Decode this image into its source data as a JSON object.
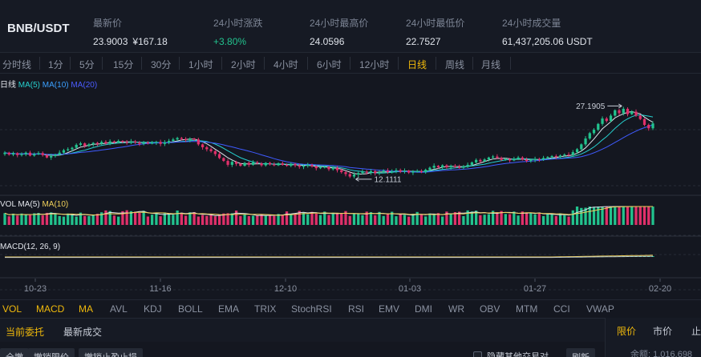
{
  "header": {
    "pair": "BNB/USDT",
    "last_label": "最新价",
    "last_price": "23.9003",
    "last_cny": "¥167.18",
    "change_label": "24小时涨跌",
    "change_value": "+3.80%",
    "high_label": "24小时最高价",
    "high_value": "24.0596",
    "low_label": "24小时最低价",
    "low_value": "22.7527",
    "volume_label": "24小时成交量",
    "volume_value": "61,437,205.06 USDT"
  },
  "intervals": [
    {
      "label": "分时线"
    },
    {
      "label": "1分"
    },
    {
      "label": "5分"
    },
    {
      "label": "15分"
    },
    {
      "label": "30分"
    },
    {
      "label": "1小时"
    },
    {
      "label": "2小时"
    },
    {
      "label": "4小时"
    },
    {
      "label": "6小时"
    },
    {
      "label": "12小时"
    },
    {
      "label": "日线"
    },
    {
      "label": "周线"
    },
    {
      "label": "月线"
    }
  ],
  "active_interval": "日线",
  "legends": {
    "main_prefix": "日线",
    "ma5": "MA(5)",
    "ma10": "MA(10)",
    "ma20": "MA(20)",
    "vol_prefix": "VOL",
    "vol_ma5": "MA(5)",
    "vol_ma10": "MA(10)",
    "macd": "MACD(12, 26, 9)"
  },
  "chart_data": {
    "type": "candlestick",
    "x_ticks": [
      "10-23",
      "11-16",
      "12-10",
      "01-03",
      "01-27",
      "02-20"
    ],
    "max_label": "27.1905",
    "min_label": "12.1111",
    "ylim": [
      9.8,
      30.5
    ],
    "series_colors": {
      "up": "#22c38e",
      "down": "#e0306a",
      "ma5": "#dfe3ea",
      "ma10": "#26d0ce",
      "ma20": "#3f5bff",
      "vol_ma5": "#dfe3ea",
      "vol_ma10": "#f0d05a"
    },
    "closes": [
      17.9,
      17.5,
      17.8,
      17.4,
      17.6,
      17.9,
      17.3,
      17.6,
      17.8,
      17.4,
      16.9,
      17.2,
      17.5,
      17.9,
      18.4,
      18.6,
      18.9,
      19.5,
      19.8,
      19.3,
      19.6,
      19.9,
      19.7,
      20.1,
      19.8,
      20.2,
      20.0,
      20.3,
      20.1,
      19.9,
      20.2,
      20.0,
      19.7,
      20.0,
      19.8,
      19.9,
      20.1,
      19.7,
      20.0,
      20.3,
      20.6,
      20.9,
      20.7,
      20.5,
      20.8,
      20.6,
      19.6,
      19.0,
      18.6,
      18.2,
      17.6,
      16.8,
      16.2,
      15.4,
      16.0,
      15.6,
      15.2,
      15.8,
      15.4,
      15.9,
      15.7,
      15.3,
      15.8,
      15.5,
      15.3,
      15.7,
      15.4,
      15.2,
      15.6,
      15.3,
      15.0,
      15.2,
      15.4,
      15.1,
      14.7,
      14.9,
      15.0,
      14.5,
      14.8,
      14.3,
      13.9,
      13.5,
      13.0,
      13.4,
      13.7,
      14.0,
      13.8,
      14.1,
      13.7,
      13.9,
      14.2,
      13.9,
      14.1,
      14.3,
      14.0,
      14.2,
      13.8,
      14.0,
      14.1,
      13.9,
      14.4,
      14.8,
      15.2,
      14.9,
      15.3,
      14.9,
      15.2,
      15.0,
      14.8,
      15.1,
      15.4,
      15.9,
      16.4,
      16.1,
      16.5,
      16.9,
      17.1,
      16.8,
      16.4,
      16.6,
      16.3,
      16.6,
      16.9,
      16.5,
      16.2,
      16.4,
      16.6,
      16.5,
      16.8,
      17.0,
      17.2,
      17.0,
      17.3,
      17.5,
      17.4,
      18.0,
      18.6,
      19.6,
      20.8,
      21.9,
      22.6,
      23.8,
      24.9,
      24.4,
      25.5,
      26.6,
      26.0,
      26.9,
      25.8,
      26.3,
      25.5,
      24.8,
      23.6,
      22.9,
      23.9
    ]
  },
  "indicators": [
    {
      "label": "VOL"
    },
    {
      "label": "MACD"
    },
    {
      "label": "MA"
    },
    {
      "label": "AVL"
    },
    {
      "label": "KDJ"
    },
    {
      "label": "BOLL"
    },
    {
      "label": "EMA"
    },
    {
      "label": "TRIX"
    },
    {
      "label": "StochRSI"
    },
    {
      "label": "RSI"
    },
    {
      "label": "EMV"
    },
    {
      "label": "DMI"
    },
    {
      "label": "WR"
    },
    {
      "label": "OBV"
    },
    {
      "label": "MTM"
    },
    {
      "label": "CCI"
    },
    {
      "label": "VWAP"
    }
  ],
  "orders": {
    "tab_current": "当前委托",
    "tab_latest": "最新成交",
    "btn_cancel_all": "全撤",
    "btn_cancel_limit": "撤销限价",
    "btn_cancel_stop": "撤销止盈止损",
    "hide_other": "隐藏其他交易对",
    "refresh": "刷新"
  },
  "order_panel": {
    "tab_limit": "限价",
    "tab_market": "市价",
    "tab_stop": "止",
    "qty_text": "余额: 1.016.698"
  }
}
